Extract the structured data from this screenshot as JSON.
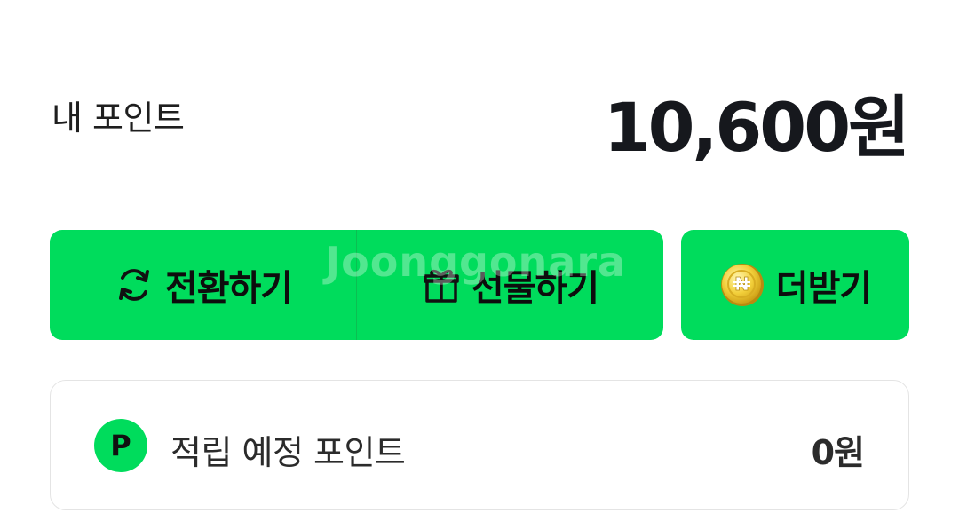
{
  "points": {
    "label": "내 포인트",
    "value": "10,600원"
  },
  "actions": {
    "convert": {
      "label": "전환하기",
      "icon": "refresh-icon"
    },
    "gift": {
      "label": "선물하기",
      "icon": "gift-icon"
    },
    "earn_more": {
      "label": "더받기",
      "icon": "coin-icon"
    }
  },
  "pending": {
    "badge": "P",
    "label": "적립 예정 포인트",
    "value": "0원"
  },
  "watermark": "Joonggonara",
  "colors": {
    "accent": "#00dc5c",
    "text": "#16181d"
  }
}
